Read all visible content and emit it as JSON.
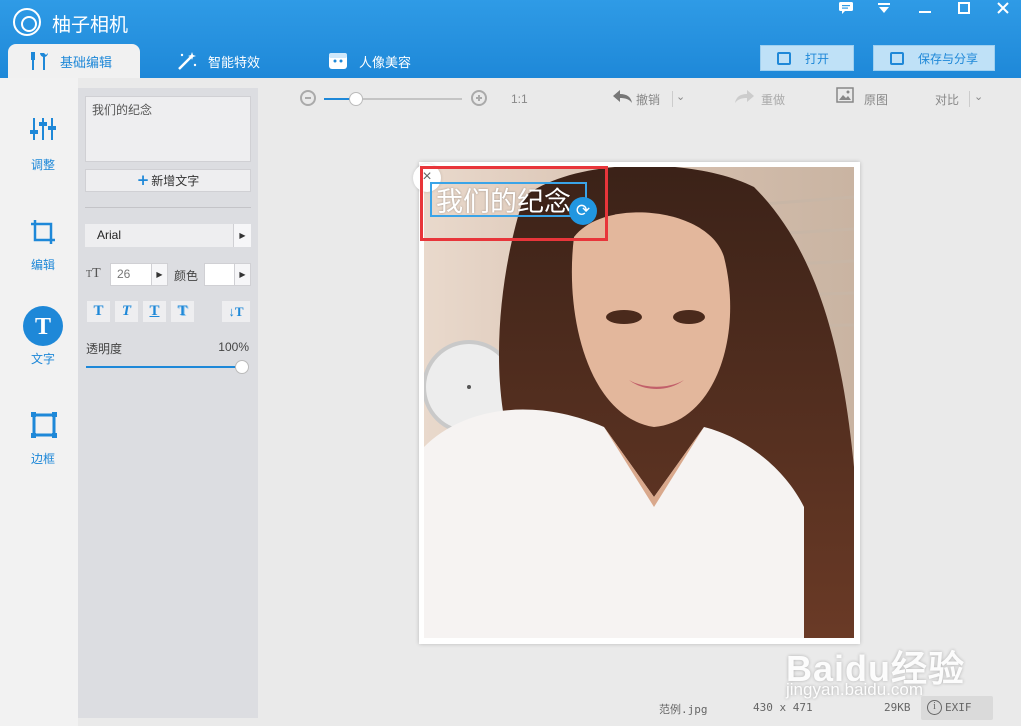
{
  "app": {
    "title": "柚子相机"
  },
  "window_controls": {
    "menu": "☰",
    "minimize": "—",
    "maximize": "☐",
    "close": "✕"
  },
  "tabs": [
    {
      "label": "基础编辑",
      "icon": "wrench-icon",
      "active": true
    },
    {
      "label": "智能特效",
      "icon": "magic-wand-icon",
      "active": false
    },
    {
      "label": "人像美容",
      "icon": "portrait-icon",
      "active": false
    }
  ],
  "header_buttons": {
    "open": "打开",
    "save_share": "保存与分享"
  },
  "tools": [
    {
      "label": "调整",
      "icon": "sliders-icon"
    },
    {
      "label": "编辑",
      "icon": "crop-icon"
    },
    {
      "label": "文字",
      "icon": "text-icon",
      "active": true
    },
    {
      "label": "边框",
      "icon": "frame-icon"
    }
  ],
  "text_panel": {
    "text_value": "我们的纪念",
    "add_text": "新增文字",
    "font": "Arial",
    "size": "26",
    "color_label": "颜色",
    "style_buttons": [
      "T",
      "T",
      "T",
      "T"
    ],
    "direction_button": "↓T",
    "opacity_label": "透明度",
    "opacity_value": "100%",
    "opacity_level": 1.0
  },
  "toolbar": {
    "zoom_ratio": "1:1",
    "zoom_level": 0.24,
    "undo": "撤销",
    "redo": "重做",
    "original": "原图",
    "compare": "对比"
  },
  "canvas": {
    "overlay_text": "我们的纪念",
    "close": "×",
    "rotate": "⟳"
  },
  "status": {
    "filename": "范例.jpg",
    "dimensions": "430 x 471",
    "filesize": "29KB",
    "exif": "EXIF"
  },
  "watermark": {
    "brand": "Baidu经验",
    "url": "jingyan.baidu.com"
  },
  "colors": {
    "accent": "#1e88d8",
    "titlebar": "#2f9be6",
    "highlight": "#e8353a"
  }
}
